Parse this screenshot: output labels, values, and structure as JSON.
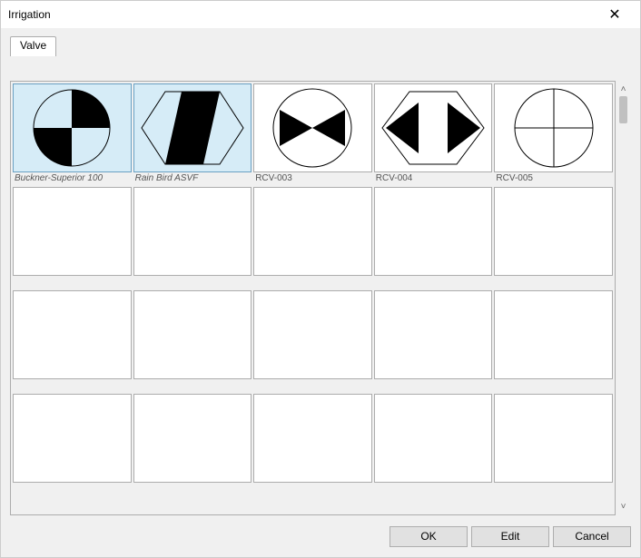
{
  "title": "Irrigation",
  "tab": "Valve",
  "close_glyph": "✕",
  "scroll_up_glyph": "˄",
  "scroll_down_glyph": "˅",
  "items": [
    {
      "label": "Buckner-Superior 100",
      "icon": "circle-quarters",
      "selected": true
    },
    {
      "label": "Rain Bird ASVF",
      "icon": "hex-angled",
      "selected": true
    },
    {
      "label": "RCV-003",
      "icon": "circle-bowtie",
      "selected": false
    },
    {
      "label": "RCV-004",
      "icon": "hex-bowtie",
      "selected": false
    },
    {
      "label": "RCV-005",
      "icon": "circle-cross",
      "selected": false
    }
  ],
  "total_slots": 20,
  "buttons": {
    "ok": "OK",
    "edit": "Edit",
    "cancel": "Cancel"
  }
}
